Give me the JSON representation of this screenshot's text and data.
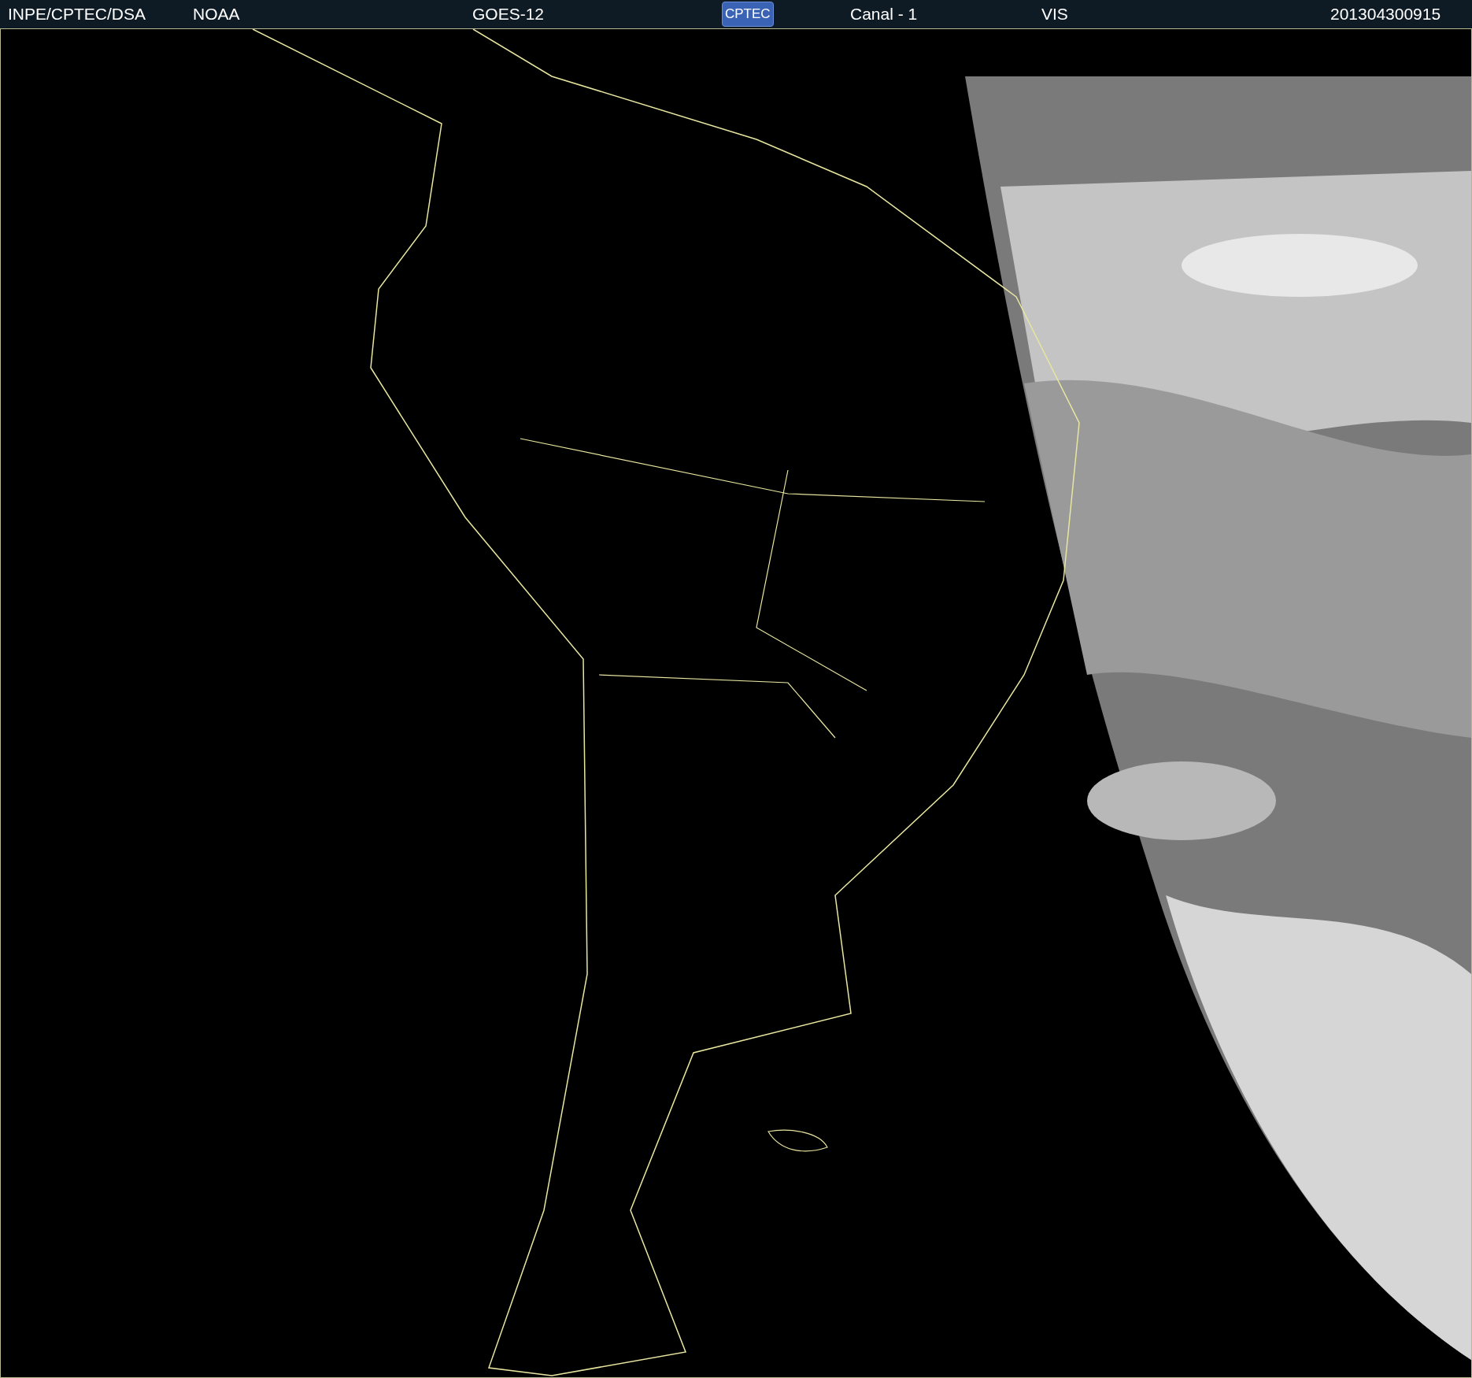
{
  "header": {
    "items": [
      {
        "kind": "text",
        "text": "INPE/CPTEC/DSA"
      },
      {
        "kind": "text",
        "text": "NOAA"
      },
      {
        "kind": "text",
        "text": "GOES-12"
      },
      {
        "kind": "logo",
        "text": "CPTEC"
      },
      {
        "kind": "text",
        "text": "Canal - 1"
      },
      {
        "kind": "text",
        "text": "VIS"
      },
      {
        "kind": "text",
        "text": "201304300915"
      }
    ]
  }
}
